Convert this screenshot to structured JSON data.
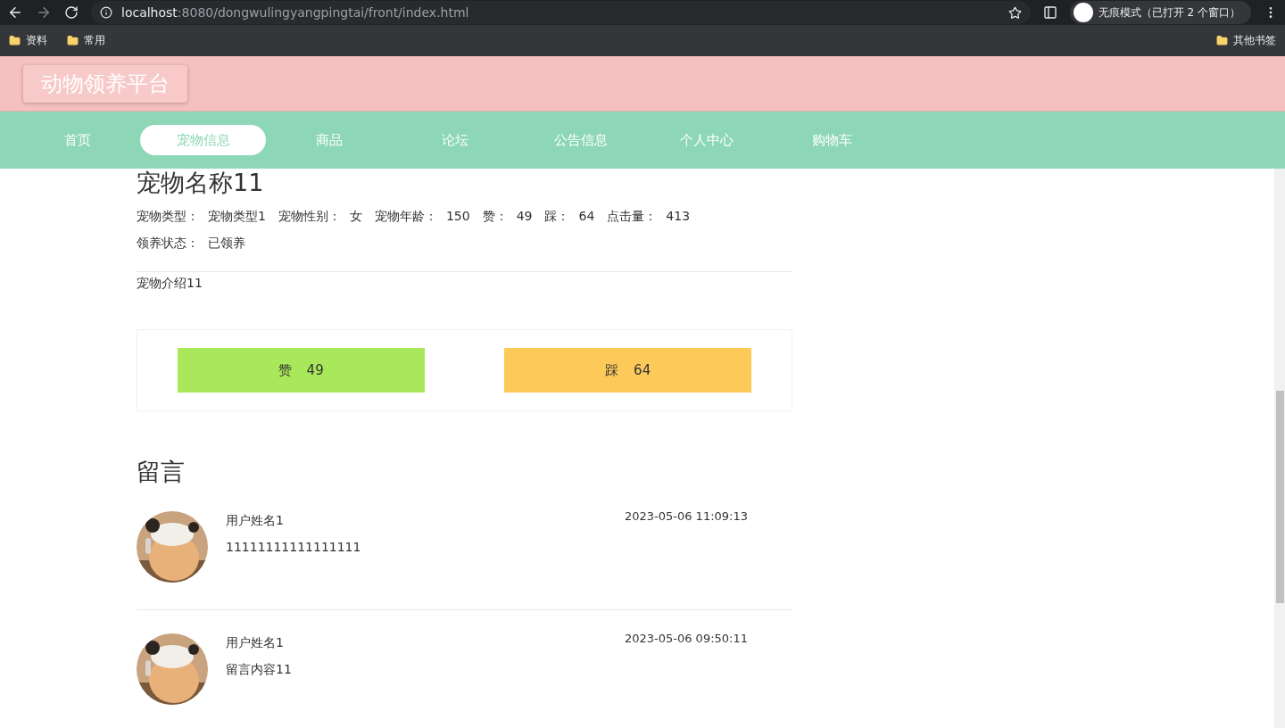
{
  "browser": {
    "url_host": "localhost",
    "url_path": ":8080/dongwulingyangpingtai/front/index.html",
    "profile": "无痕模式（已打开 2 个窗口）",
    "bookmarks": [
      "资料",
      "常用"
    ],
    "other_bookmarks": "其他书签"
  },
  "site": {
    "logo": "动物领养平台"
  },
  "nav": [
    {
      "label": "首页",
      "selected": false
    },
    {
      "label": "宠物信息",
      "selected": true
    },
    {
      "label": "商品",
      "selected": false
    },
    {
      "label": "论坛",
      "selected": false
    },
    {
      "label": "公告信息",
      "selected": false
    },
    {
      "label": "个人中心",
      "selected": false
    },
    {
      "label": "购物车",
      "selected": false
    }
  ],
  "pet": {
    "name": "宠物名称11",
    "fields": [
      {
        "label": "宠物类型：",
        "value": "宠物类型1"
      },
      {
        "label": "宠物性别：",
        "value": "女"
      },
      {
        "label": "宠物年龄：",
        "value": "150"
      },
      {
        "label": "赞：",
        "value": "49"
      },
      {
        "label": "踩：",
        "value": "64"
      },
      {
        "label": "点击量：",
        "value": "413"
      }
    ],
    "status": {
      "label": "领养状态：",
      "value": "已领养"
    },
    "intro": "宠物介绍11",
    "votes": [
      {
        "kind": "like",
        "label": "赞",
        "count": "49"
      },
      {
        "kind": "dislike",
        "label": "踩",
        "count": "64"
      }
    ]
  },
  "comments": {
    "title": "留言",
    "items": [
      {
        "user": "用户姓名1",
        "text": "11111111111111111",
        "time": "2023-05-06 11:09:13"
      },
      {
        "user": "用户姓名1",
        "text": "留言内容11",
        "time": "2023-05-06 09:50:11"
      }
    ]
  }
}
